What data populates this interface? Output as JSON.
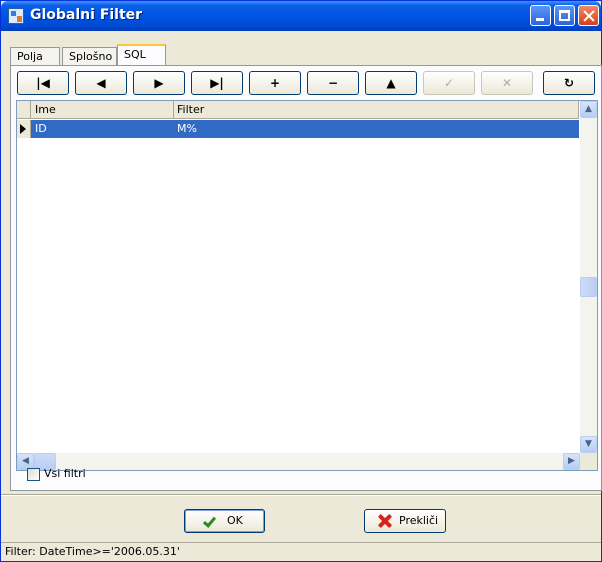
{
  "window": {
    "title": "Globalni Filter"
  },
  "tabs": [
    {
      "label": "Polja",
      "active": false
    },
    {
      "label": "Splošno",
      "active": false
    },
    {
      "label": "SQL",
      "active": true
    }
  ],
  "navigator": [
    {
      "name": "first",
      "glyph": "|◀",
      "enabled": true
    },
    {
      "name": "prior",
      "glyph": "◀",
      "enabled": true
    },
    {
      "name": "next",
      "glyph": "▶",
      "enabled": true
    },
    {
      "name": "last",
      "glyph": "▶|",
      "enabled": true
    },
    {
      "name": "insert",
      "glyph": "+",
      "enabled": true
    },
    {
      "name": "delete",
      "glyph": "−",
      "enabled": true
    },
    {
      "name": "edit",
      "glyph": "▲",
      "enabled": true
    },
    {
      "name": "post",
      "glyph": "✓",
      "enabled": false
    },
    {
      "name": "cancel",
      "glyph": "✕",
      "enabled": false
    },
    {
      "name": "refresh",
      "glyph": "↻",
      "enabled": true
    }
  ],
  "grid": {
    "columns": [
      "Ime",
      "Filter"
    ],
    "rows": [
      {
        "ime": "ID",
        "filter": "M%",
        "selected": true
      }
    ]
  },
  "checkbox": {
    "label": "Vsi filtri",
    "checked": false
  },
  "buttons": {
    "ok": "OK",
    "cancel": "Prekliči"
  },
  "status": {
    "text": "Filter: DateTime>='2006.05.31'"
  },
  "colors": {
    "titlebar": "#0054e3",
    "selection": "#316ac5",
    "face": "#ece9d8"
  }
}
